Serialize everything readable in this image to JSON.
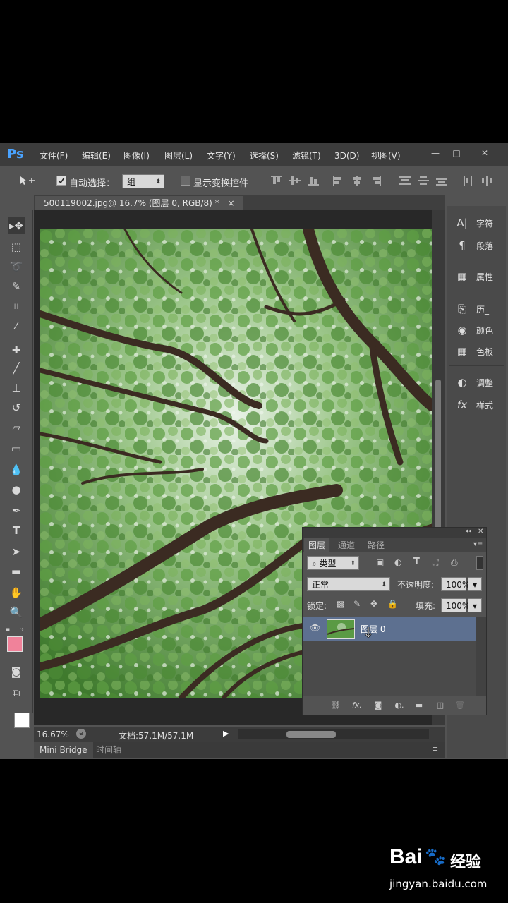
{
  "menubar": {
    "logo": "Ps",
    "items": [
      "文件(F)",
      "编辑(E)",
      "图像(I)",
      "图层(L)",
      "文字(Y)",
      "选择(S)",
      "滤镜(T)",
      "3D(D)",
      "视图(V)"
    ],
    "window_min": "—",
    "window_restore": "□",
    "window_close": "✕"
  },
  "options": {
    "auto_select_label": "自动选择：",
    "auto_select_checked": true,
    "auto_select_value": "组",
    "show_transform_label": "显示变换控件",
    "show_transform_checked": false
  },
  "document_tab": {
    "label": "500119002.jpg@ 16.7% (图层 0, RGB/8) *",
    "close": "×"
  },
  "tools": [
    "move-tool",
    "marquee-tool",
    "lasso-tool",
    "quick-selection-tool",
    "crop-tool",
    "eyedropper-tool",
    "healing-brush-tool",
    "brush-tool",
    "clone-stamp-tool",
    "history-brush-tool",
    "eraser-tool",
    "gradient-tool",
    "blur-tool",
    "dodge-tool",
    "pen-tool",
    "type-tool",
    "path-selection-tool",
    "rectangle-tool",
    "hand-tool",
    "zoom-tool"
  ],
  "colors": {
    "foreground": "#f0829a",
    "background": "#ffffff",
    "accent": "#4aa3ff",
    "selected_layer": "#5d7090"
  },
  "status": {
    "zoom": "16.67%",
    "doc_info": "文档:57.1M/57.1M"
  },
  "bottom_tabs": {
    "mini_bridge": "Mini Bridge",
    "timeline": "时间轴"
  },
  "right_dock": {
    "groups": [
      [
        {
          "icon": "character-icon",
          "glyph": "A|",
          "label": "字符"
        },
        {
          "icon": "paragraph-icon",
          "glyph": "¶",
          "label": "段落"
        }
      ],
      [
        {
          "icon": "properties-icon",
          "glyph": "▦",
          "label": "属性"
        }
      ],
      [
        {
          "icon": "history-icon",
          "glyph": "⎘",
          "label": "历_"
        },
        {
          "icon": "color-icon",
          "glyph": "◉",
          "label": "颜色"
        },
        {
          "icon": "swatches-icon",
          "glyph": "▦",
          "label": "色板"
        }
      ],
      [
        {
          "icon": "adjustments-icon",
          "glyph": "◐",
          "label": "调整"
        },
        {
          "icon": "styles-icon",
          "glyph": "fx",
          "label": "样式"
        }
      ]
    ]
  },
  "layers_panel": {
    "tabs": [
      "图层",
      "通道",
      "路径"
    ],
    "filter_kind": "类型",
    "blend_mode": "正常",
    "opacity_label": "不透明度:",
    "opacity_value": "100%",
    "lock_label": "锁定:",
    "fill_label": "填充:",
    "fill_value": "100%",
    "layer_name": "图层 0"
  },
  "watermark": {
    "brand": "Bai",
    "paw": "🐾",
    "suffix": "经验",
    "url": "jingyan.baidu.com"
  }
}
